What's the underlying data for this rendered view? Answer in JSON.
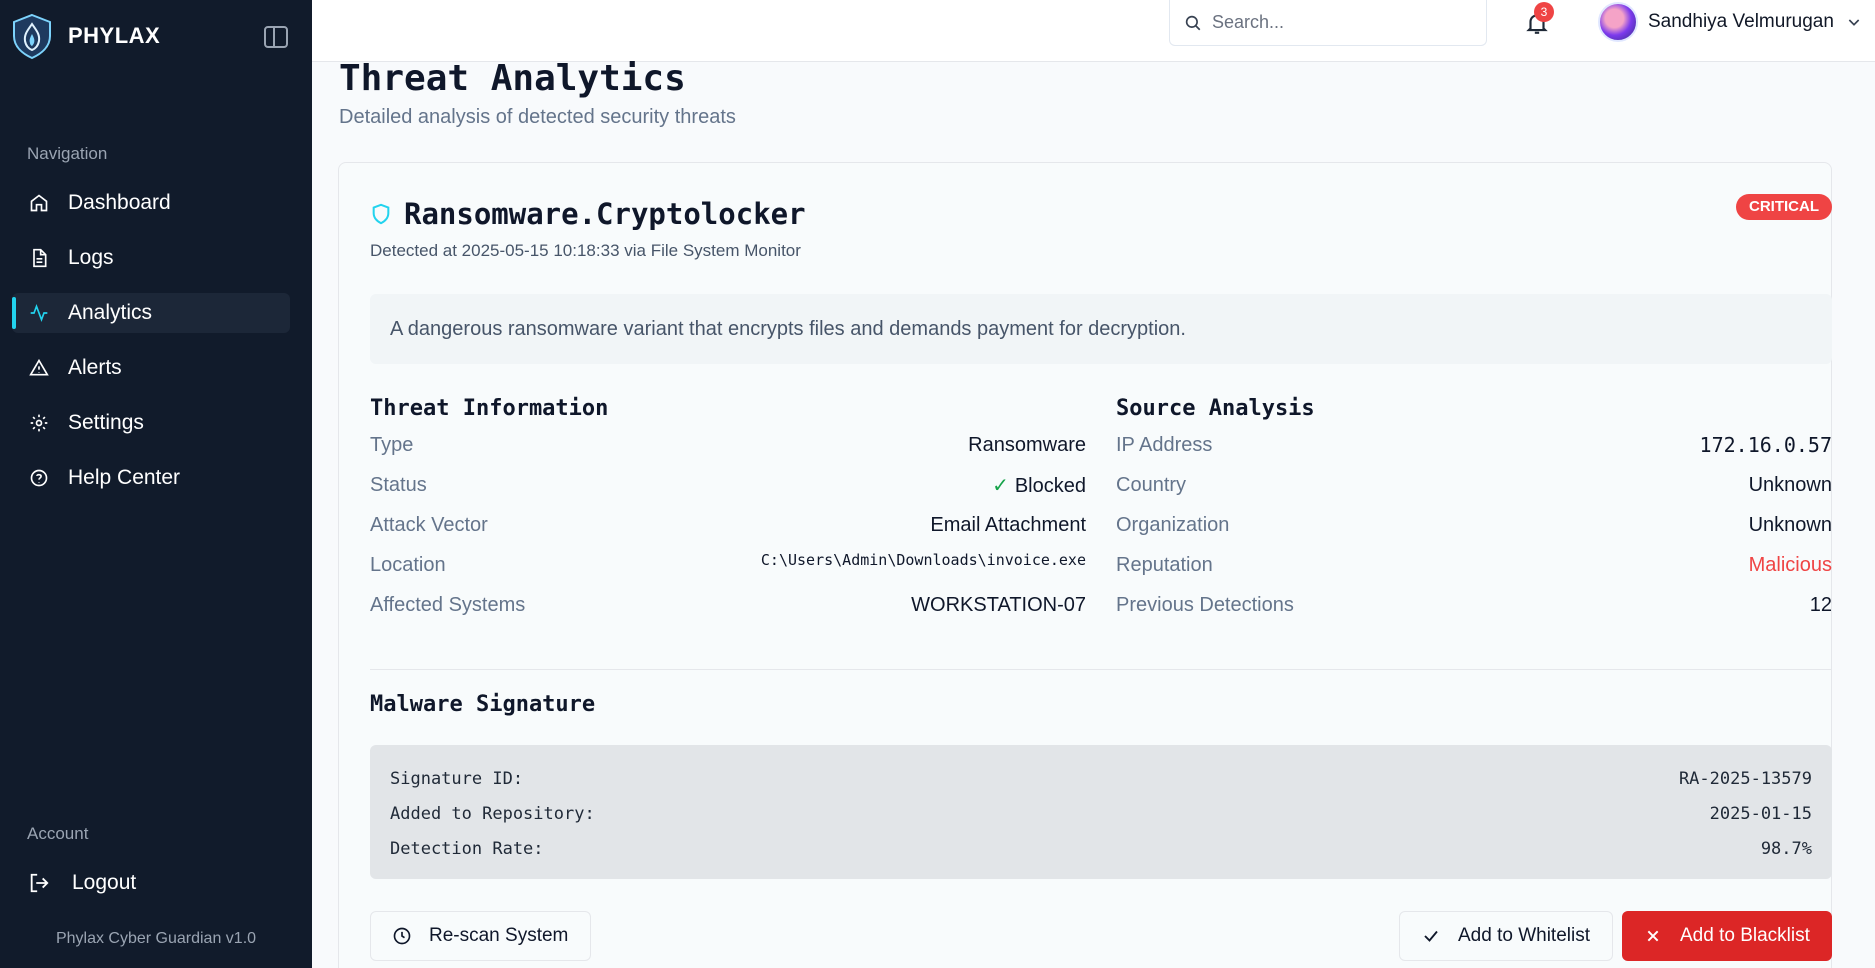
{
  "brand": {
    "name": "PHYLAX"
  },
  "sidebar": {
    "section_label": "Navigation",
    "items": [
      {
        "label": "Dashboard",
        "icon": "home-icon"
      },
      {
        "label": "Logs",
        "icon": "file-icon"
      },
      {
        "label": "Analytics",
        "icon": "activity-icon",
        "active": true
      },
      {
        "label": "Alerts",
        "icon": "alert-triangle-icon"
      },
      {
        "label": "Settings",
        "icon": "gear-icon"
      },
      {
        "label": "Help Center",
        "icon": "help-circle-icon"
      }
    ],
    "account_label": "Account",
    "logout_label": "Logout",
    "version": "Phylax Cyber Guardian v1.0"
  },
  "header": {
    "search_placeholder": "Search...",
    "notification_count": "3",
    "user_name": "Sandhiya Velmurugan"
  },
  "page": {
    "title": "Threat Analytics",
    "subtitle": "Detailed analysis of detected security threats"
  },
  "threat": {
    "name": "Ransomware.Cryptolocker",
    "detected": "Detected at 2025-05-15 10:18:33 via File System Monitor",
    "severity": "CRITICAL",
    "description": "A dangerous ransomware variant that encrypts files and demands payment for decryption."
  },
  "threat_info": {
    "title": "Threat Information",
    "rows": [
      {
        "key": "Type",
        "value": "Ransomware"
      },
      {
        "key": "Status",
        "value": "Blocked"
      },
      {
        "key": "Attack Vector",
        "value": "Email Attachment"
      },
      {
        "key": "Location",
        "value": "C:\\Users\\Admin\\Downloads\\invoice.exe"
      },
      {
        "key": "Affected Systems",
        "value": "WORKSTATION-07"
      }
    ]
  },
  "source_analysis": {
    "title": "Source Analysis",
    "rows": [
      {
        "key": "IP Address",
        "value": "172.16.0.57"
      },
      {
        "key": "Country",
        "value": "Unknown"
      },
      {
        "key": "Organization",
        "value": "Unknown"
      },
      {
        "key": "Reputation",
        "value": "Malicious"
      },
      {
        "key": "Previous Detections",
        "value": "12"
      }
    ]
  },
  "signature": {
    "title": "Malware Signature",
    "rows": [
      {
        "key": "Signature ID:",
        "value": "RA-2025-13579"
      },
      {
        "key": "Added to Repository:",
        "value": "2025-01-15"
      },
      {
        "key": "Detection Rate:",
        "value": "98.7%"
      }
    ]
  },
  "actions": {
    "rescan": "Re-scan System",
    "whitelist": "Add to Whitelist",
    "blacklist": "Add to Blacklist"
  },
  "colors": {
    "sidebar_bg": "#111b2b",
    "accent": "#22d3ee",
    "critical": "#ef4444",
    "success": "#16a34a"
  }
}
